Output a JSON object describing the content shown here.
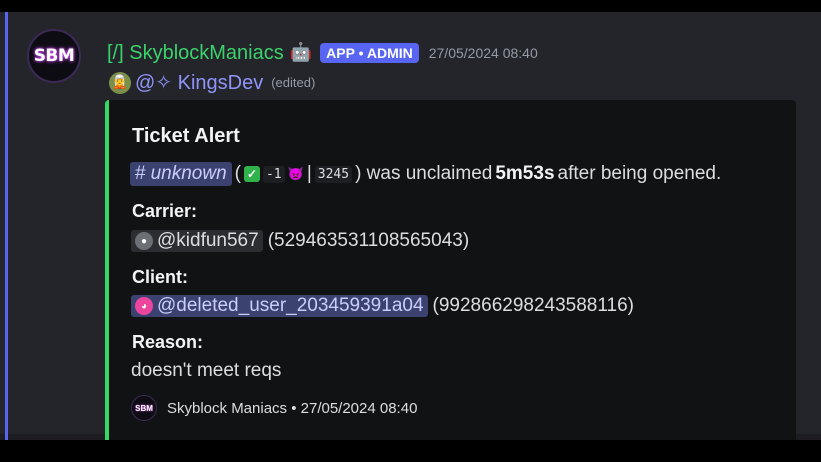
{
  "message": {
    "avatar_text": "SBM",
    "username": "[/] SkyblockManiacs",
    "bot_emoji": "🤖",
    "app_tag": "APP • ADMIN",
    "timestamp": "27/05/2024 08:40",
    "interaction_user": "@✧ KingsDev",
    "edited_label": "(edited)"
  },
  "embed": {
    "accent_color": "#34d964",
    "title": "Ticket Alert",
    "description": {
      "channel_hash": "#",
      "channel_name": "unknown",
      "open_paren": "(",
      "check_emoji": "✓",
      "code_a": "-1",
      "demon_emoji": "👿",
      "separator": "|",
      "code_b": "3245",
      "close_text": ") was unclaimed",
      "duration": "5m53s",
      "suffix": "after being opened."
    },
    "fields": [
      {
        "name": "Carrier:",
        "mention": "@kidfun567",
        "id": "(529463531108565043)"
      },
      {
        "name": "Client:",
        "mention": "@deleted_user_203459391a04",
        "id": "(992866298243588116)"
      },
      {
        "name": "Reason:",
        "value": "doesn't meet reqs"
      }
    ],
    "footer": {
      "icon_text": "SBM",
      "text": "Skyblock Maniacs • 27/05/2024 08:40"
    }
  }
}
